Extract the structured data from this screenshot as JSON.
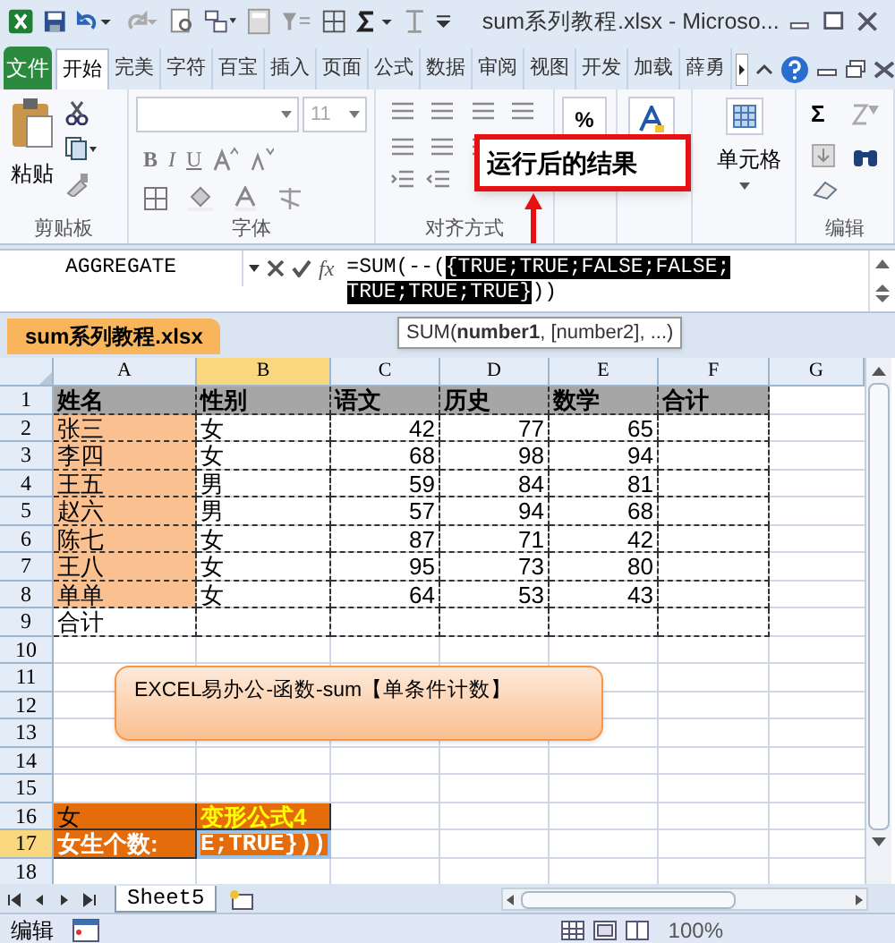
{
  "window": {
    "title": "sum系列教程.xlsx  -  Microso..."
  },
  "ribbon": {
    "file_tab": "文件",
    "tabs": [
      {
        "label": "开始",
        "selected": true
      },
      {
        "label": "完美",
        "selected": false
      },
      {
        "label": "字符",
        "selected": false
      },
      {
        "label": "百宝",
        "selected": false
      },
      {
        "label": "插入",
        "selected": false
      },
      {
        "label": "页面",
        "selected": false
      },
      {
        "label": "公式",
        "selected": false
      },
      {
        "label": "数据",
        "selected": false
      },
      {
        "label": "审阅",
        "selected": false
      },
      {
        "label": "视图",
        "selected": false
      },
      {
        "label": "开发",
        "selected": false
      },
      {
        "label": "加载",
        "selected": false
      },
      {
        "label": "薛勇",
        "selected": false
      }
    ],
    "clipboard": {
      "label": "剪贴板",
      "paste": "粘贴"
    },
    "font": {
      "label": "字体",
      "size": "11",
      "style_buttons": [
        "B",
        "I",
        "U"
      ]
    },
    "alignment": {
      "label": "对齐方式"
    },
    "number": {
      "symbol": "%"
    },
    "cells": {
      "button": "单元格"
    },
    "editing": {
      "label": "编辑",
      "symbol": "Σ"
    }
  },
  "callout": {
    "text": "运行后的结果"
  },
  "formula_bar": {
    "name_box": "AGGREGATE",
    "function_button": "fx",
    "formula_start": "=SUM(--(",
    "formula_highlight": "{TRUE;TRUE;FALSE;FALSE;TRUE;TRUE;TRUE}",
    "formula_end": "))"
  },
  "workbook_tab": "sum系列教程.xlsx",
  "tooltip": "SUM(**number1**, [number2], ...)",
  "grid": {
    "columns": [
      {
        "label": "A",
        "selected": false
      },
      {
        "label": "B",
        "selected": true
      },
      {
        "label": "C",
        "selected": false
      },
      {
        "label": "D",
        "selected": false
      },
      {
        "label": "E",
        "selected": false
      },
      {
        "label": "F",
        "selected": false
      },
      {
        "label": "G",
        "selected": false
      }
    ],
    "rows": [
      {
        "number": "1",
        "kind": "header",
        "selected": false,
        "cells": [
          "姓名",
          "性别",
          "语文",
          "历史",
          "数学",
          "合计"
        ]
      },
      {
        "number": "2",
        "kind": "record",
        "selected": false,
        "cells": [
          "张三",
          "女",
          "42",
          "77",
          "65"
        ]
      },
      {
        "number": "3",
        "kind": "record",
        "selected": false,
        "cells": [
          "李四",
          "女",
          "68",
          "98",
          "94"
        ]
      },
      {
        "number": "4",
        "kind": "record",
        "selected": false,
        "cells": [
          "王五",
          "男",
          "59",
          "84",
          "81"
        ]
      },
      {
        "number": "5",
        "kind": "record",
        "selected": false,
        "cells": [
          "赵六",
          "男",
          "57",
          "94",
          "68"
        ]
      },
      {
        "number": "6",
        "kind": "record",
        "selected": false,
        "cells": [
          "陈七",
          "女",
          "87",
          "71",
          "42"
        ]
      },
      {
        "number": "7",
        "kind": "record",
        "selected": false,
        "cells": [
          "王八",
          "女",
          "95",
          "73",
          "80"
        ]
      },
      {
        "number": "8",
        "kind": "record",
        "selected": false,
        "cells": [
          "单单",
          "女",
          "64",
          "53",
          "43"
        ]
      },
      {
        "number": "9",
        "kind": "total",
        "selected": false,
        "cells": [
          "合计"
        ]
      },
      {
        "number": "10",
        "kind": "blank",
        "selected": false,
        "cells": []
      },
      {
        "number": "11",
        "kind": "blank",
        "selected": false,
        "cells": []
      },
      {
        "number": "12",
        "kind": "blank",
        "selected": false,
        "cells": []
      },
      {
        "number": "13",
        "kind": "blank",
        "selected": false,
        "cells": []
      },
      {
        "number": "14",
        "kind": "blank",
        "selected": false,
        "cells": []
      },
      {
        "number": "15",
        "kind": "blank",
        "selected": false,
        "cells": []
      },
      {
        "number": "16",
        "kind": "orange_label",
        "selected": false,
        "cells": [
          "女",
          "变形公式4"
        ]
      },
      {
        "number": "17",
        "kind": "orange_result",
        "selected": true,
        "cells": [
          "女生个数:",
          "E;TRUE}))"
        ]
      },
      {
        "number": "18",
        "kind": "blank",
        "selected": false,
        "cells": []
      }
    ]
  },
  "text_box": {
    "text": "EXCEL易办公-函数-sum【单条件计数】"
  },
  "sheet_tabs": [
    {
      "label": "Sheet5",
      "selected": true
    }
  ],
  "status_bar": {
    "mode": "编辑",
    "zoom": "100%"
  }
}
